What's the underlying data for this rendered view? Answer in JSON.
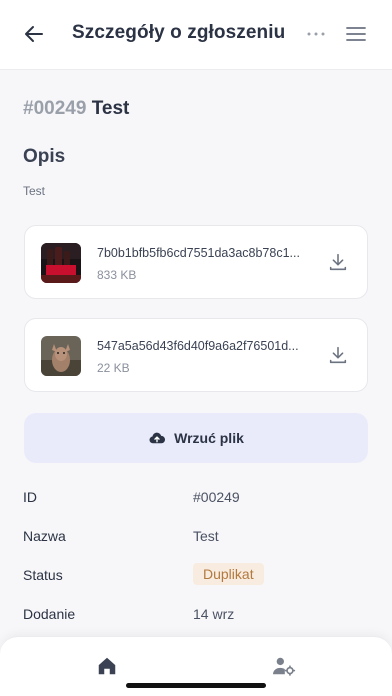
{
  "header": {
    "title": "Szczegóły o zgłoszeniu"
  },
  "ticket": {
    "number": "#00249",
    "name": "Test"
  },
  "description": {
    "heading": "Opis",
    "text": "Test"
  },
  "files": [
    {
      "name": "7b0b1bfb5fb6cd7551da3ac8b78c1...",
      "size": "833 KB",
      "thumb_icon": "cola-bottles-thumbnail"
    },
    {
      "name": "547a5a56d43f6d40f9a6a2f76501d...",
      "size": "22 KB",
      "thumb_icon": "kangaroo-thumbnail"
    }
  ],
  "upload": {
    "label": "Wrzuć plik",
    "icon": "cloud-upload-icon"
  },
  "details": [
    {
      "label": "ID",
      "value": "#00249"
    },
    {
      "label": "Nazwa",
      "value": "Test"
    },
    {
      "label": "Status",
      "value": "Duplikat"
    },
    {
      "label": "Dodanie",
      "value": "14 wrz"
    }
  ],
  "colors": {
    "accent_bg": "#e9ebfb",
    "badge_bg": "#f7ecdf",
    "badge_text": "#b27a3e",
    "text": "#2b3344"
  },
  "bottom_nav": {
    "items": [
      "home-icon",
      "user-settings-icon"
    ]
  }
}
